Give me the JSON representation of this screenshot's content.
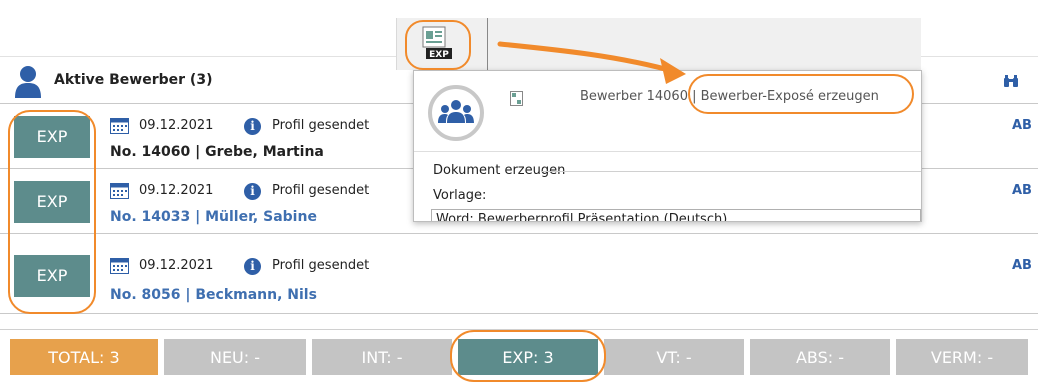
{
  "header": {
    "title": "Aktive Bewerber (3)",
    "search_icon": "binoculars-icon"
  },
  "rows": [
    {
      "exp": "EXP",
      "date": "09.12.2021",
      "status": "Profil gesendet",
      "candidate": "No. 14060 | Grebe, Martina",
      "tag": "AB"
    },
    {
      "exp": "EXP",
      "date": "09.12.2021",
      "status": "Profil gesendet",
      "candidate": "No. 14033 | Müller, Sabine",
      "tag": "AB"
    },
    {
      "exp": "EXP",
      "date": "09.12.2021",
      "status": "Profil gesendet",
      "candidate": "No. 8056 | Beckmann, Nils",
      "tag": "AB"
    }
  ],
  "info_glyph": "i",
  "tabs": [
    {
      "label": "TOTAL: 3"
    },
    {
      "label": "NEU: -"
    },
    {
      "label": "INT: -"
    },
    {
      "label": "EXP: 3"
    },
    {
      "label": "VT: -"
    },
    {
      "label": "ABS: -"
    },
    {
      "label": "VERM: -"
    }
  ],
  "toolbar": {
    "exp_label": "EXP"
  },
  "popup": {
    "title": "Bewerber 14060 | Bewerber-Exposé erzeugen",
    "section": "Dokument erzeugen",
    "vorlage_label": "Vorlage:",
    "template_value": "Word: Bewerberprofil Präsentation (Deutsch)"
  },
  "colors": {
    "accent_orange": "#f18a2b",
    "exp_teal": "#5d8c8c",
    "link_blue": "#3f6fb0",
    "tab_total": "#e7a14c",
    "tab_inactive": "#c4c4c4"
  }
}
